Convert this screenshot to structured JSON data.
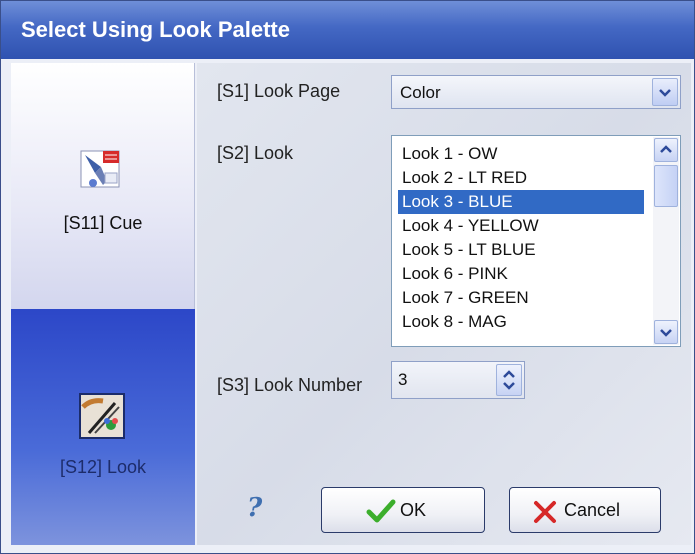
{
  "window": {
    "title": "Select Using Look Palette"
  },
  "sidebar": {
    "items": [
      {
        "label": "[S11] Cue",
        "icon": "cue-icon",
        "selected": false
      },
      {
        "label": "[S12] Look",
        "icon": "look-icon",
        "selected": true
      }
    ]
  },
  "form": {
    "look_page_label": "[S1] Look Page",
    "look_page_value": "Color",
    "look_label": "[S2] Look",
    "look_items": [
      "Look 1 - OW",
      "Look 2 - LT RED",
      "Look 3 - BLUE",
      "Look 4 - YELLOW",
      "Look 5 - LT BLUE",
      "Look 6 - PINK",
      "Look 7 - GREEN",
      "Look 8 - MAG"
    ],
    "selected_index": 2,
    "look_number_label": "[S3] Look Number",
    "look_number_value": "3"
  },
  "buttons": {
    "help": "?",
    "ok": "OK",
    "cancel": "Cancel"
  },
  "colors": {
    "title_bar": "#3a5bbd",
    "selection": "#316ac5",
    "sidebar_active": "#3b58cf"
  }
}
